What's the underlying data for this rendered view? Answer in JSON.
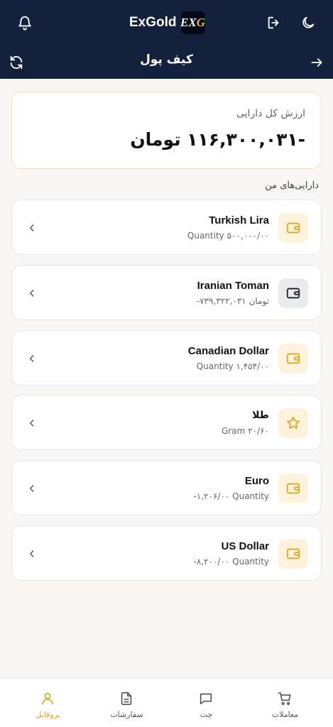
{
  "header": {
    "brand": "ExGold",
    "brand_logo_main": "EX",
    "brand_logo_accent": "G",
    "page_title": "کیف پول",
    "icons": {
      "notifications": "bell-icon",
      "logout": "logout-icon",
      "theme": "moon-icon",
      "refresh": "refresh-icon",
      "back": "arrow-right-icon"
    }
  },
  "summary": {
    "label": "ارزش کل دارایی",
    "value": "-۱۱۶,۳۰۰,۰۳۱ تومان"
  },
  "assets_section": {
    "title": "دارایی‌های من",
    "items": [
      {
        "name": "Turkish Lira",
        "sub": "Quantity ۵۰۰,۰۰۰/۰۰",
        "icon": "wallet-icon"
      },
      {
        "name": "Iranian Toman",
        "sub": "-۷۳۹,۳۲۲,۰۳۱ تومان",
        "icon": "wallet-icon"
      },
      {
        "name": "Canadian Dollar",
        "sub": "Quantity ۱,۴۵۴/۰۰",
        "icon": "wallet-icon"
      },
      {
        "name": "طلا",
        "sub": "Gram ۲۰/۶۰",
        "icon": "star-icon"
      },
      {
        "name": "Euro",
        "sub": "-۱,۲۰۶/۰۰ Quantity",
        "icon": "wallet-icon"
      },
      {
        "name": "US Dollar",
        "sub": "-۸,۲۰۰/۰۰ Quantity",
        "icon": "wallet-icon"
      }
    ]
  },
  "bottom_nav": {
    "items": [
      {
        "label": "معاملات",
        "icon": "cart-icon"
      },
      {
        "label": "چت",
        "icon": "chat-icon"
      },
      {
        "label": "سفارشات",
        "icon": "document-icon"
      },
      {
        "label": "پروفایل",
        "icon": "user-icon",
        "active": true
      }
    ]
  },
  "colors": {
    "header_bg": "#14213d",
    "accent": "#d9a21b",
    "icon_tile": "#fdf3dc",
    "icon_tile_neutral": "#e9ebef"
  }
}
